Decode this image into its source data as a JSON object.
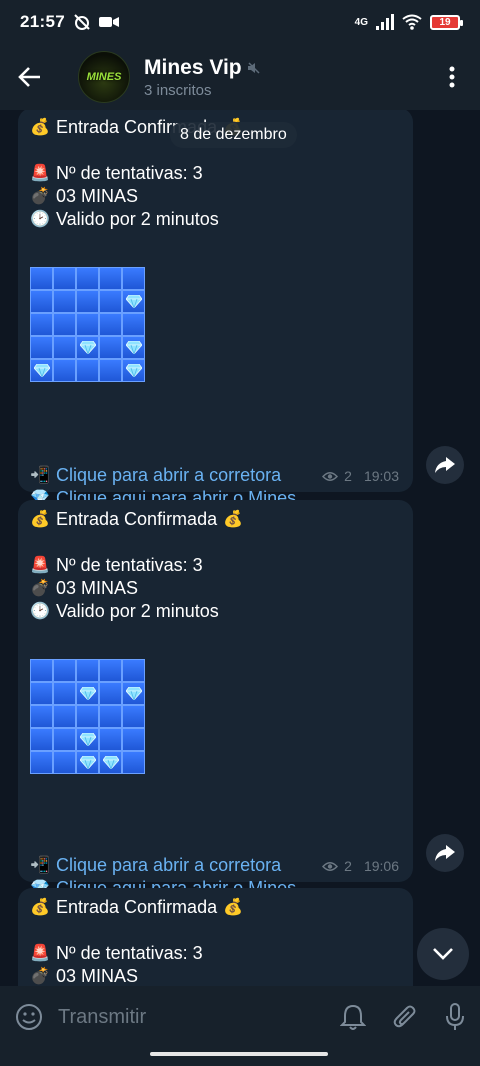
{
  "status": {
    "time": "21:57",
    "network": "4G",
    "battery": "19"
  },
  "header": {
    "title": "Mines Vip",
    "subtitle": "3 inscritos",
    "avatar_text": "MINES"
  },
  "date_pill": "8 de dezembro",
  "messages": [
    {
      "title": "Entrada Confirmada",
      "attempts": "Nº de tentativas: 3",
      "mines": "03 MINAS",
      "valid": "Valido por 2 minutos",
      "link1": "Clique para abrir a corretora",
      "link2": "Clique aqui para abrir o Mines",
      "views": "2",
      "time": "19:03",
      "grid": [
        [
          0,
          0,
          0,
          0,
          0
        ],
        [
          0,
          0,
          0,
          0,
          1
        ],
        [
          0,
          0,
          0,
          0,
          0
        ],
        [
          0,
          0,
          1,
          0,
          1
        ],
        [
          1,
          0,
          0,
          0,
          1
        ]
      ]
    },
    {
      "title": "Entrada Confirmada",
      "attempts": "Nº de tentativas: 3",
      "mines": "03 MINAS",
      "valid": "Valido por 2 minutos",
      "link1": "Clique para abrir a corretora",
      "link2": "Clique aqui para abrir o Mines",
      "views": "2",
      "time": "19:06",
      "grid": [
        [
          0,
          0,
          0,
          0,
          0
        ],
        [
          0,
          0,
          1,
          0,
          1
        ],
        [
          0,
          0,
          0,
          0,
          0
        ],
        [
          0,
          0,
          1,
          0,
          0
        ],
        [
          0,
          0,
          1,
          1,
          0
        ]
      ]
    },
    {
      "title": "Entrada Confirmada",
      "attempts": "Nº de tentativas: 3",
      "mines": "03 MINAS"
    }
  ],
  "input": {
    "placeholder": "Transmitir"
  },
  "icons": {
    "back": "arrow-left-icon",
    "menu": "more-vertical-icon",
    "muted": "muted-speaker-icon",
    "money": "money-bag-icon",
    "siren": "siren-icon",
    "bomb": "bomb-icon",
    "clock": "clock-icon",
    "phone": "mobile-arrow-icon",
    "diamond": "diamond-icon",
    "eye": "eye-icon",
    "share": "share-icon",
    "down": "chevron-down-icon",
    "emoji": "emoji-icon",
    "bell": "bell-icon",
    "attach": "paperclip-icon",
    "mic": "microphone-icon"
  },
  "colors": {
    "background": "#0e1621",
    "bar": "#17212b",
    "bubble": "#182533",
    "link": "#6ab2f2",
    "tile": "#2f6df0"
  }
}
